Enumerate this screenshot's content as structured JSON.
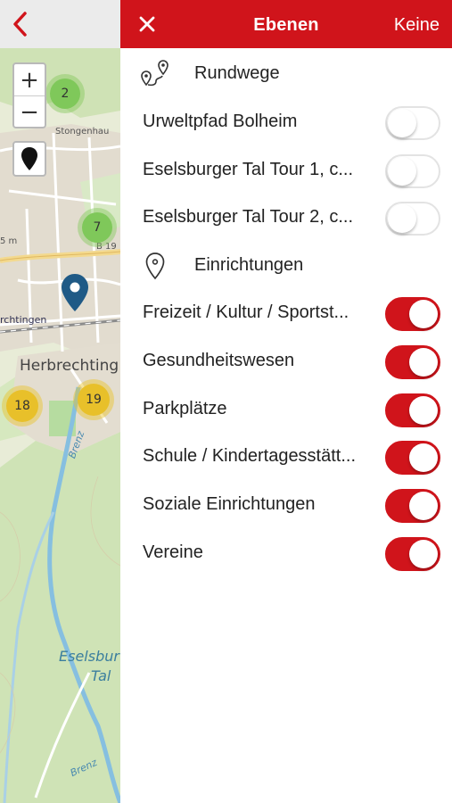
{
  "map": {
    "back_icon": "chevron-left-icon",
    "zoom_in": "+",
    "zoom_out": "−",
    "location_icon": "map-marker-icon",
    "labels": {
      "stongenhau": "Stongenhau",
      "b19": "B 19",
      "m_label": "5 m",
      "brechtingen": "rchtingen",
      "herbrechting": "Herbrechting",
      "brenz_1": "Brenz",
      "eselsburg": "Eselsbur",
      "tal": "Tal",
      "brenz_2": "Brenz"
    },
    "clusters": [
      {
        "count": "2",
        "color": "green"
      },
      {
        "count": "7",
        "color": "green"
      },
      {
        "count": "18",
        "color": "yellow"
      },
      {
        "count": "19",
        "color": "yellow"
      }
    ],
    "pin_color": "#1f5a86"
  },
  "header": {
    "close_icon": "close-icon",
    "title": "Ebenen",
    "right_action": "Keine",
    "color": "#d0141b"
  },
  "sections": [
    {
      "icon": "route-icon",
      "title": "Rundwege",
      "items": [
        {
          "label": "Urweltpfad Bolheim",
          "enabled": false
        },
        {
          "label": "Eselsburger Tal Tour 1, c...",
          "enabled": false
        },
        {
          "label": "Eselsburger Tal Tour 2, c...",
          "enabled": false
        }
      ]
    },
    {
      "icon": "location-pin-icon",
      "title": "Einrichtungen",
      "items": [
        {
          "label": "Freizeit / Kultur / Sportst...",
          "enabled": true
        },
        {
          "label": "Gesundheitswesen",
          "enabled": true
        },
        {
          "label": "Parkplätze",
          "enabled": true
        },
        {
          "label": "Schule / Kindertagesstätt...",
          "enabled": true
        },
        {
          "label": "Soziale Einrichtungen",
          "enabled": true
        },
        {
          "label": "Vereine",
          "enabled": true
        }
      ]
    }
  ]
}
